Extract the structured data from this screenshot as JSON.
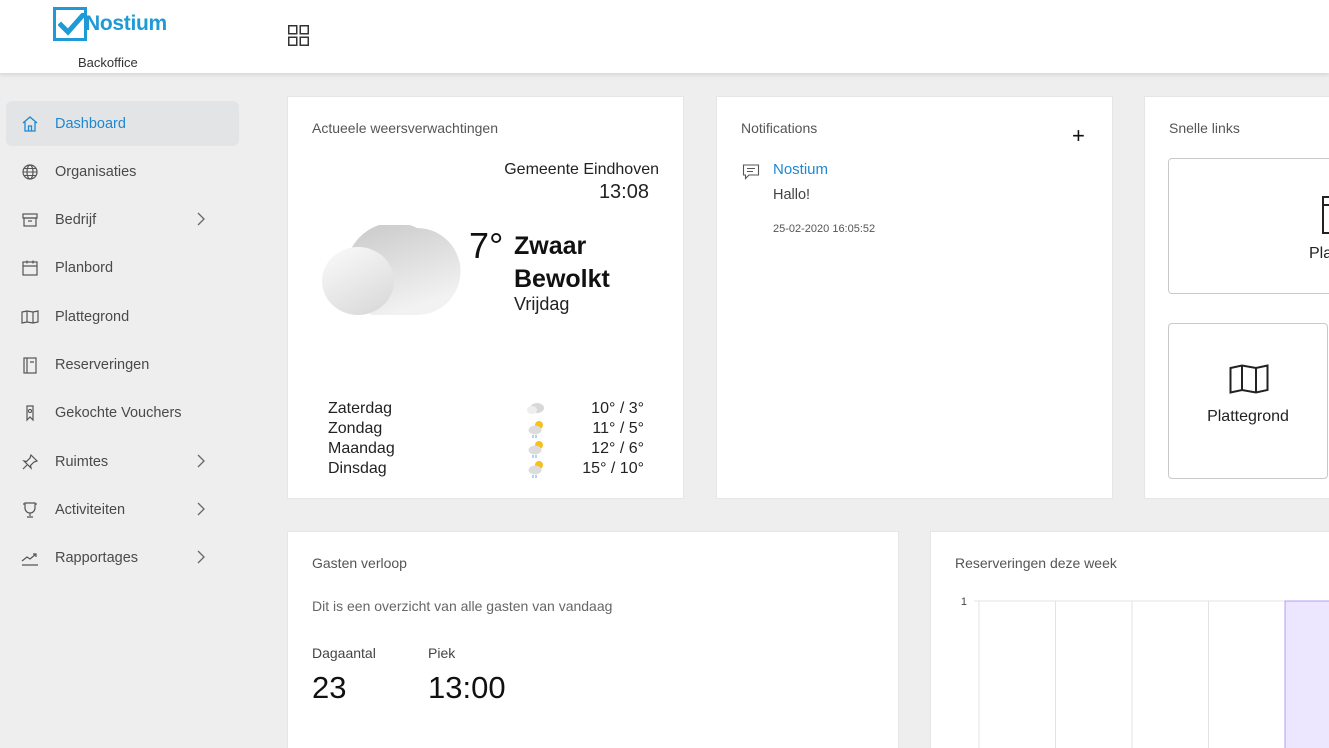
{
  "header": {
    "brand": "Nostium",
    "subtitle": "Backoffice",
    "brand_color": "#1e9ad6"
  },
  "sidebar": {
    "items": [
      {
        "label": "Dashboard",
        "icon": "home-icon",
        "active": true,
        "has_submenu": false
      },
      {
        "label": "Organisaties",
        "icon": "globe-icon",
        "active": false,
        "has_submenu": false
      },
      {
        "label": "Bedrijf",
        "icon": "archive-box-icon",
        "active": false,
        "has_submenu": true
      },
      {
        "label": "Planbord",
        "icon": "calendar-icon",
        "active": false,
        "has_submenu": false
      },
      {
        "label": "Plattegrond",
        "icon": "map-icon",
        "active": false,
        "has_submenu": false
      },
      {
        "label": "Reserveringen",
        "icon": "notebook-icon",
        "active": false,
        "has_submenu": false
      },
      {
        "label": "Gekochte Vouchers",
        "icon": "ticket-icon",
        "active": false,
        "has_submenu": false
      },
      {
        "label": "Ruimtes",
        "icon": "pin-icon",
        "active": false,
        "has_submenu": true
      },
      {
        "label": "Activiteiten",
        "icon": "trophy-icon",
        "active": false,
        "has_submenu": true
      },
      {
        "label": "Rapportages",
        "icon": "trend-icon",
        "active": false,
        "has_submenu": true
      }
    ],
    "active_color": "#1e88d0"
  },
  "weather": {
    "title": "Actueele weersverwachtingen",
    "city": "Gemeente Eindhoven",
    "time": "13:08",
    "temp": "7°",
    "condition": "Zwaar Bewolkt",
    "day": "Vrijdag",
    "forecast": [
      {
        "day": "Zaterdag",
        "icon": "cloud-icon",
        "temp": "10° / 3°"
      },
      {
        "day": "Zondag",
        "icon": "sun-cloud-rain-icon",
        "temp": "11° / 5°"
      },
      {
        "day": "Maandag",
        "icon": "sun-cloud-rain-icon",
        "temp": "12° / 6°"
      },
      {
        "day": "Dinsdag",
        "icon": "sun-cloud-rain-icon",
        "temp": "15° / 10°"
      }
    ]
  },
  "notifications": {
    "title": "Notifications",
    "add_label": "+",
    "items": [
      {
        "sender": "Nostium",
        "message": "Hallo!",
        "date": "25-02-2020 16:05:52"
      }
    ]
  },
  "quick_links": {
    "title": "Snelle links",
    "tiles": [
      {
        "label": "Pla",
        "icon": "document-icon"
      },
      {
        "label": "Plattegrond",
        "icon": "map-icon"
      }
    ]
  },
  "guests": {
    "title": "Gasten verloop",
    "description": "Dit is een overzicht van alle gasten van vandaag",
    "daily_label": "Dagaantal",
    "daily_value": "23",
    "peak_label": "Piek",
    "peak_value": "13:00"
  },
  "reservations": {
    "title": "Reserveringen deze week"
  },
  "chart_data": {
    "type": "bar",
    "title": "Reserveringen deze week",
    "ytick_labels": [
      "1"
    ],
    "ylim": [
      0,
      1
    ],
    "visible_columns": 5,
    "highlighted_column": 5,
    "bar_color": "#ece6ff",
    "bar_border_color": "#b49cf5",
    "grid": true
  }
}
